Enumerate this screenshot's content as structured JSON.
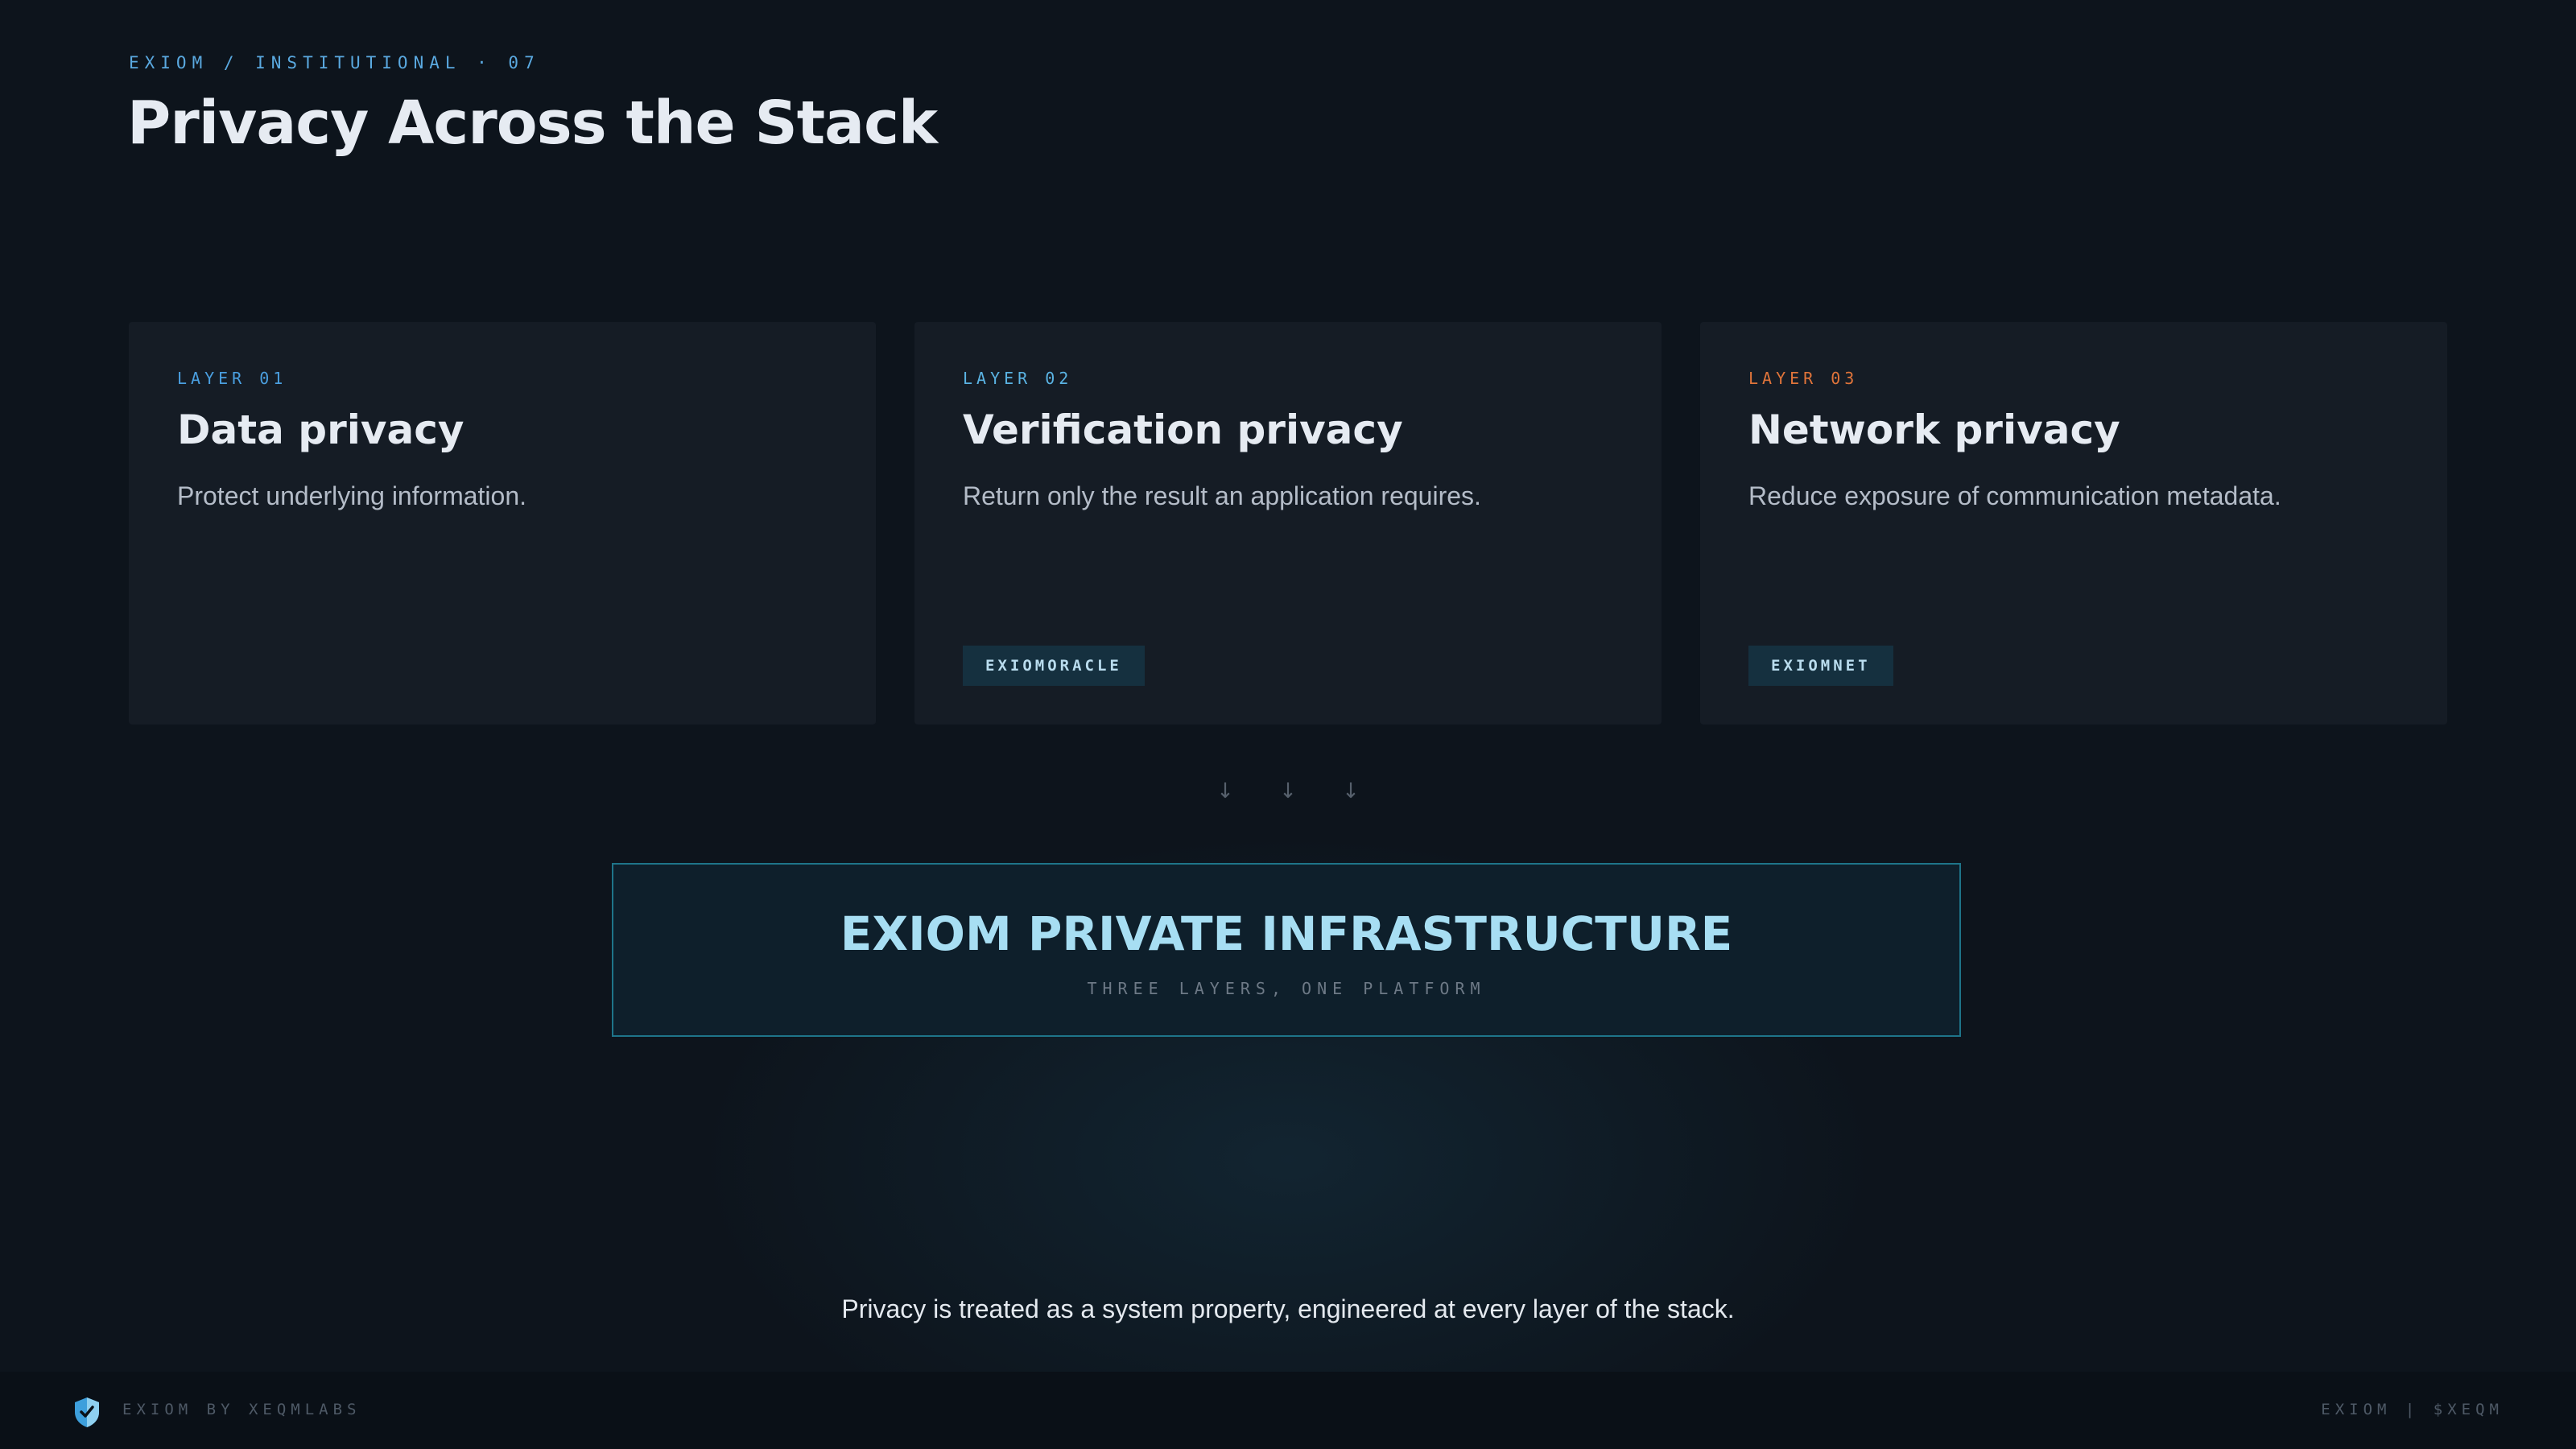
{
  "header": {
    "kicker": "EXIOM / INSTITUTIONAL · 07",
    "title": "Privacy Across the Stack"
  },
  "layers": [
    {
      "label": "LAYER 01",
      "title": "Data privacy",
      "description": "Protect underlying information.",
      "accent": "#4a9fe0"
    },
    {
      "label": "LAYER 02",
      "title": "Verification privacy",
      "description": "Return only the result an application requires.",
      "tag": "EXIOMORACLE",
      "accent": "#5ab3e3"
    },
    {
      "label": "LAYER 03",
      "title": "Network privacy",
      "description": "Reduce exposure of communication metadata.",
      "tag": "EXIOMNET",
      "accent": "#e0743a"
    }
  ],
  "connectors": {
    "icon": "arrow-down-icon",
    "glyph": "↓",
    "count": 3
  },
  "infrastructure": {
    "title": "EXIOM PRIVATE INFRASTRUCTURE",
    "subtitle": "THREE LAYERS, ONE PLATFORM",
    "border_color": "#1e7489"
  },
  "statement": "Privacy is treated as a system property, engineered at every layer of the stack.",
  "footer": {
    "logo_icon": "shield-icon",
    "brand": "EXIOM BY XEQMLABS",
    "ticker": "EXIOM | $XEQM"
  },
  "colors": {
    "background": "#0d141c",
    "card": "#151c25",
    "accent_blue": "#5aa9e0",
    "accent_orange": "#e0743a",
    "infra_text": "#a7def3"
  }
}
